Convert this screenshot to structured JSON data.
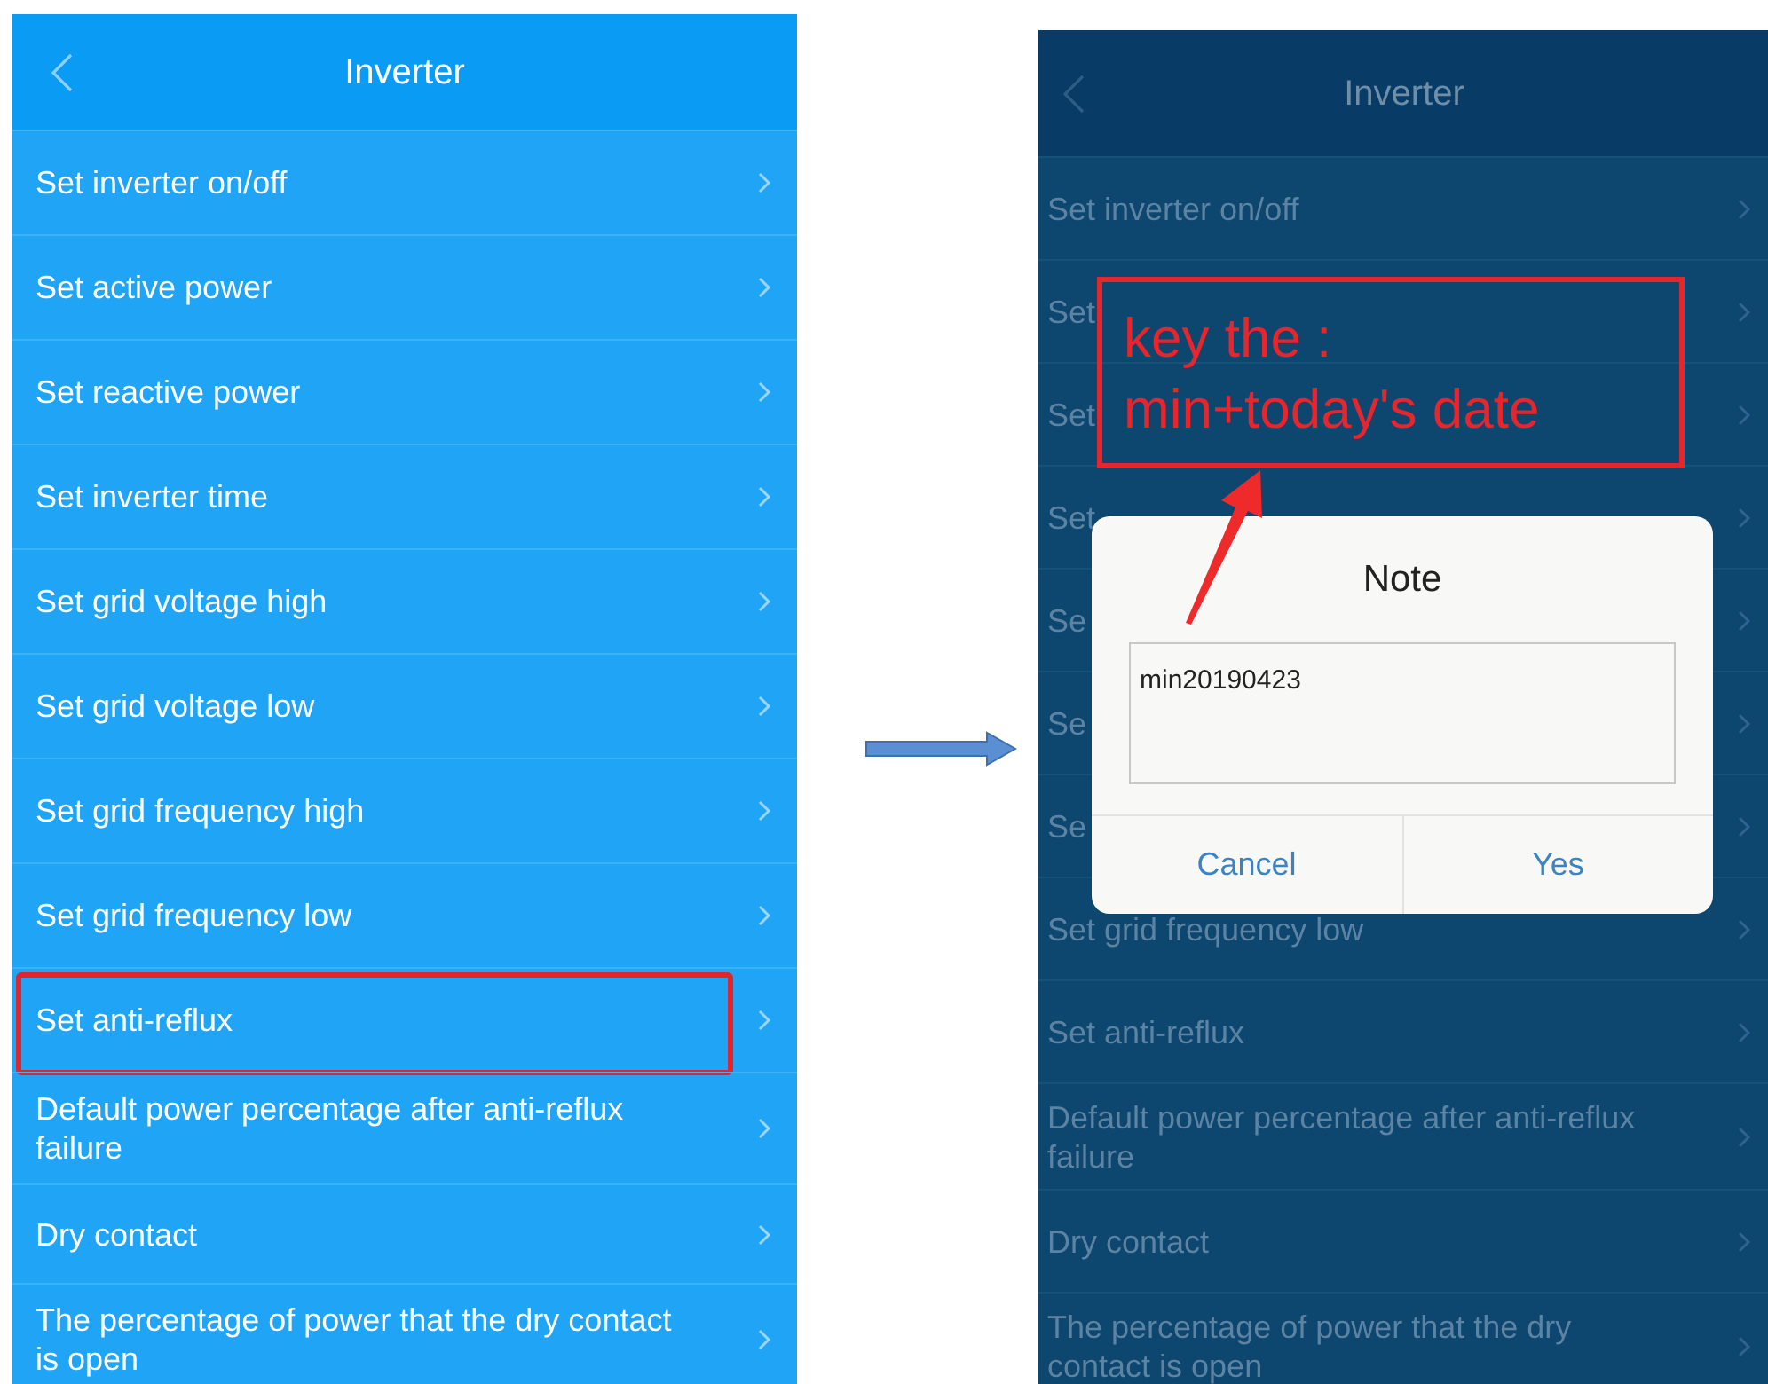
{
  "screens": [
    {
      "dimmed": false,
      "title": "Inverter",
      "items": [
        {
          "label": "Set inverter on/off",
          "highlighted": false
        },
        {
          "label": "Set active power",
          "highlighted": false
        },
        {
          "label": "Set reactive power",
          "highlighted": false
        },
        {
          "label": "Set inverter time",
          "highlighted": false
        },
        {
          "label": "Set grid voltage high",
          "highlighted": false
        },
        {
          "label": "Set grid voltage low",
          "highlighted": false
        },
        {
          "label": "Set grid frequency high",
          "highlighted": false
        },
        {
          "label": "Set grid frequency low",
          "highlighted": false
        },
        {
          "label": "Set anti-reflux",
          "highlighted": true
        },
        {
          "label": "Default power percentage after anti-reflux failure",
          "highlighted": false
        },
        {
          "label": "Dry contact",
          "highlighted": false
        },
        {
          "label": "The percentage of power that the dry contact is open",
          "highlighted": false
        }
      ]
    },
    {
      "dimmed": true,
      "title": "Inverter",
      "items": [
        {
          "label": "Set inverter on/off",
          "highlighted": false
        },
        {
          "label": "Set",
          "highlighted": false
        },
        {
          "label": "Set",
          "highlighted": false
        },
        {
          "label": "Set",
          "highlighted": false
        },
        {
          "label": "Se",
          "highlighted": false
        },
        {
          "label": "Se",
          "highlighted": false
        },
        {
          "label": "Se",
          "highlighted": false
        },
        {
          "label": "Set grid frequency low",
          "highlighted": false
        },
        {
          "label": "Set anti-reflux",
          "highlighted": false
        },
        {
          "label": "Default power percentage after anti-reflux failure",
          "highlighted": false
        },
        {
          "label": "Dry contact",
          "highlighted": false
        },
        {
          "label": "The percentage of power that the dry contact is open",
          "highlighted": false
        }
      ]
    }
  ],
  "annotation": {
    "lines": [
      "key the :",
      "min+today's date"
    ]
  },
  "dialog": {
    "title": "Note",
    "value": "min20190423",
    "buttons": [
      "Cancel",
      "Yes"
    ]
  }
}
